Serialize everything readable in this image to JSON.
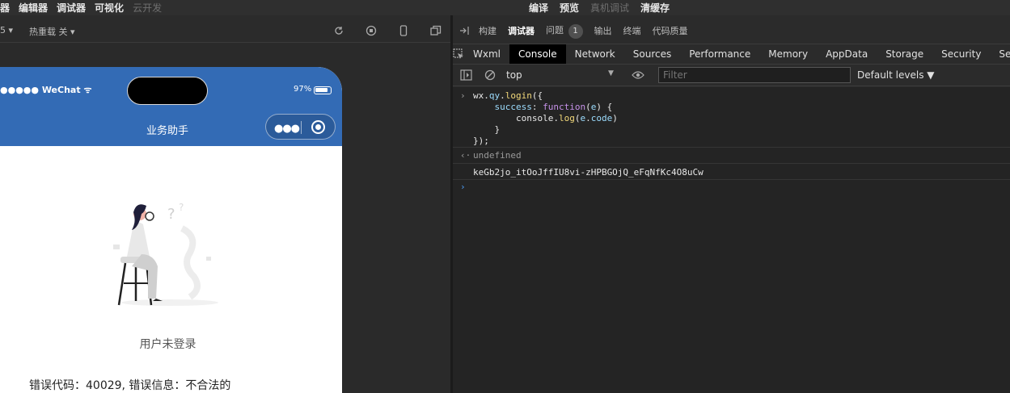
{
  "menu": [
    "器",
    "编辑器",
    "调试器",
    "可视化",
    "云开发"
  ],
  "menu_dim_index": 4,
  "center_menu": [
    "编译",
    "预览",
    "真机调试",
    "清缓存"
  ],
  "center_dim_index": 2,
  "simbar": {
    "scale_label": "5 ▾",
    "hot_reload": "热重载 关 ▾"
  },
  "phone": {
    "status_left": "●●●●● WeChat",
    "battery": "97%",
    "title": "业务助手",
    "message": "用户未登录",
    "error": "错误代码：40029, 错误信息：不合法的"
  },
  "devtop": {
    "items": [
      "构建",
      "调试器",
      "问题",
      "输出",
      "终端",
      "代码质量"
    ],
    "active": "调试器",
    "issues_count": "1"
  },
  "tabs": {
    "items": [
      "Wxml",
      "Console",
      "Network",
      "Sources",
      "Performance",
      "Memory",
      "AppData",
      "Storage",
      "Security",
      "Ser"
    ],
    "active": "Console"
  },
  "filterbar": {
    "context": "top",
    "filter_placeholder": "Filter",
    "levels": "Default levels ▼"
  },
  "console": {
    "code_lines": [
      "wx.qy.login({",
      "    success: function(e) {",
      "        console.log(e.code)",
      "    }",
      "});"
    ],
    "result": "undefined",
    "output": "keGb2jo_itOoJffIU8vi-zHPBGOjQ_eFqNfKc4O8uCw"
  },
  "colors": {
    "nav_blue": "#336bb5",
    "console_bg": "#242424",
    "tab_active_bg": "#000000"
  }
}
